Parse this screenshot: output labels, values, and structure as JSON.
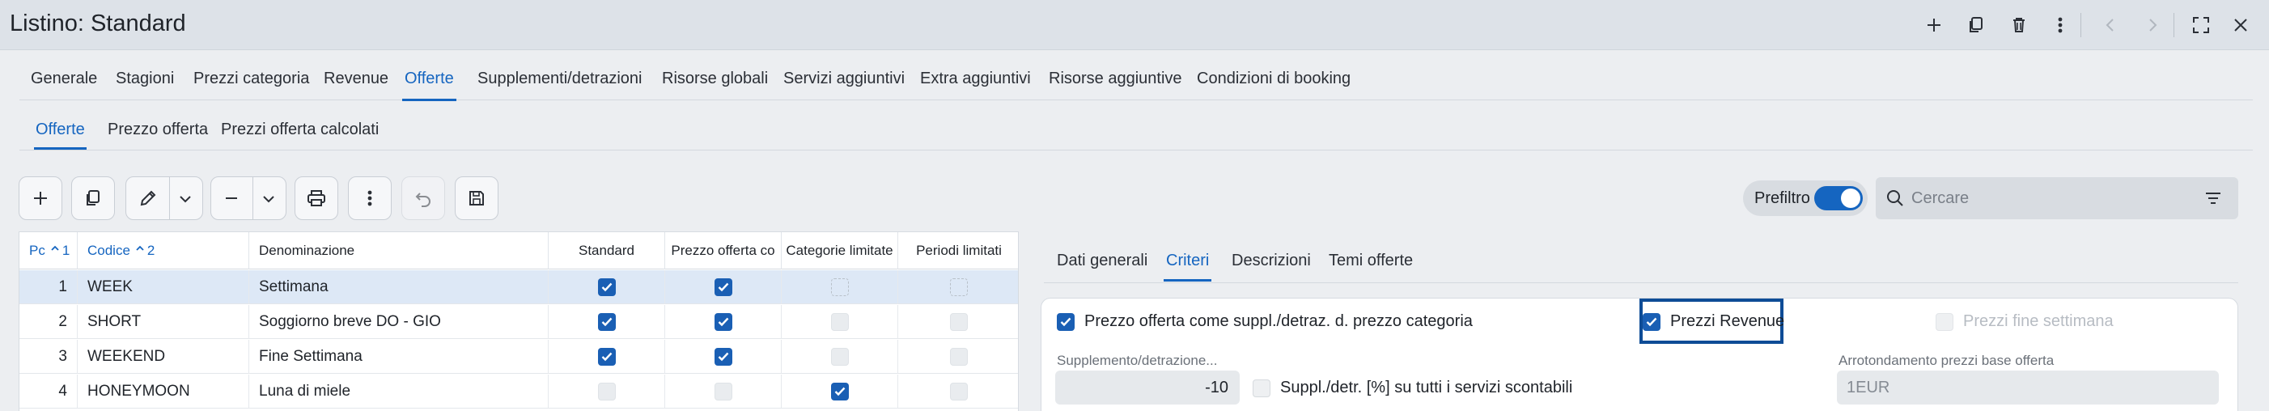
{
  "window": {
    "title": "Listino: Standard",
    "icons": [
      "plus-icon",
      "copy-icon",
      "trash-icon",
      "more-vertical-icon",
      "chevron-left-icon",
      "chevron-right-icon",
      "fullscreen-icon",
      "close-icon"
    ]
  },
  "main_tabs": [
    {
      "label": "Generale"
    },
    {
      "label": "Stagioni"
    },
    {
      "label": "Prezzi categoria"
    },
    {
      "label": "Revenue"
    },
    {
      "label": "Offerte",
      "active": true
    },
    {
      "label": "Supplementi/detrazioni"
    },
    {
      "label": "Risorse globali"
    },
    {
      "label": "Servizi aggiuntivi"
    },
    {
      "label": "Extra aggiuntivi"
    },
    {
      "label": "Risorse aggiuntive"
    },
    {
      "label": "Condizioni di booking"
    }
  ],
  "sub_tabs": [
    {
      "label": "Offerte",
      "active": true
    },
    {
      "label": "Prezzo offerta"
    },
    {
      "label": "Prezzi offerta calcolati"
    }
  ],
  "toolbar": {
    "icons": [
      "plus-icon",
      "copy-icon",
      "pencil-icon",
      "chevron-down-icon",
      "minus-icon",
      "chevron-down-icon",
      "print-icon",
      "more-vertical-icon",
      "undo-icon",
      "save-icon"
    ]
  },
  "prefilter": {
    "label": "Prefiltro",
    "on": true
  },
  "search": {
    "placeholder": "Cercare"
  },
  "table": {
    "columns": [
      "Pc",
      "1",
      "Codice",
      "2",
      "Denominazione",
      "Standard",
      "Prezzo offerta co",
      "Categorie limitate",
      "Periodi limitati"
    ],
    "rows": [
      {
        "pc": "1",
        "code": "WEEK",
        "name": "Settimana",
        "standard": true,
        "prezzo": true,
        "categorie": false,
        "periodi": false,
        "selected": true
      },
      {
        "pc": "2",
        "code": "SHORT",
        "name": "Soggiorno breve DO - GIO",
        "standard": true,
        "prezzo": true,
        "categorie": false,
        "periodi": false
      },
      {
        "pc": "3",
        "code": "WEEKEND",
        "name": "Fine Settimana",
        "standard": true,
        "prezzo": true,
        "categorie": false,
        "periodi": false
      },
      {
        "pc": "4",
        "code": "HONEYMOON",
        "name": "Luna di miele",
        "standard": false,
        "prezzo": false,
        "categorie": true,
        "periodi": false
      }
    ]
  },
  "detail_tabs": [
    {
      "label": "Dati generali"
    },
    {
      "label": "Criteri",
      "active": true
    },
    {
      "label": "Descrizioni"
    },
    {
      "label": "Temi offerte"
    }
  ],
  "criteria": {
    "prezzo_offerta_label": "Prezzo offerta come suppl./detraz. d. prezzo categoria",
    "prezzo_offerta_checked": true,
    "prezzi_revenue_label": "Prezzi Revenue",
    "prezzi_revenue_checked": true,
    "prezzi_weekend_label": "Prezzi fine settimana",
    "prezzi_weekend_checked": false,
    "supplemento_label": "Supplemento/detrazione...",
    "supplemento_value": "-10",
    "suppl_percent_label": "Suppl./detr. [%] su tutti i servizi scontabili",
    "suppl_percent_checked": false,
    "arrotondamento_label": "Arrotondamento prezzi base offerta",
    "arrotondamento_value": "1EUR"
  },
  "colors": {
    "accent": "#1565c0",
    "checkbox": "#1a5fb4",
    "highlight": "#0e4c96"
  }
}
